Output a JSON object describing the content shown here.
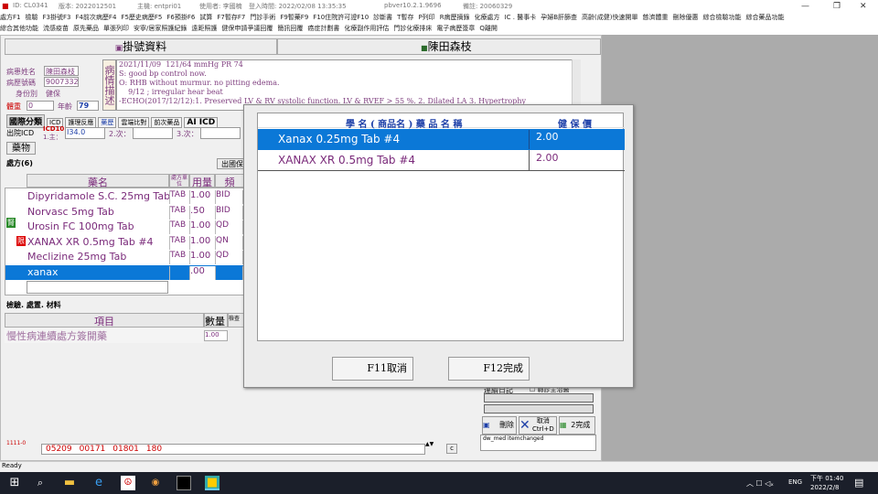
{
  "titlebar": {
    "id": "ID: CL0341",
    "host": "版本: 2022012501",
    "server": "主機: entpri01",
    "user": "使用者: 李國楠",
    "login": "登入時間: 2022/02/08 13:35:35",
    "version": "pbver10.2.1.9696",
    "note": "備註: 20060329"
  },
  "menu1": [
    "處方F1",
    "檢驗",
    "F3掛號F3",
    "F4前次病歷F4",
    "F5歷史病歷F5",
    "F6預掛F6",
    "試算",
    "F7暫存F7",
    "門診手術",
    "F9暫藥F9",
    "F10住院許可證F10",
    "診斷書",
    "T暫存",
    "P列印",
    "R病歷摘錄",
    "化療處方",
    "IC . 醫事卡",
    "孕婦B肝篩查",
    "高齡(成健)快速開單",
    "慈濟體重",
    "刪除優惠",
    "綜合檢驗功能",
    "綜合藥品功能"
  ],
  "menu2": [
    "綜合其他功能",
    "流感疫苗",
    "原先藥品",
    "單張列印",
    "安寧/居家照護紀錄",
    "遠距照護",
    "健保申請爭議回覆",
    "簡訊回覆",
    "癌症計劃書",
    "化療副作用評估",
    "門診化療排床",
    "電子病歷簽章",
    "Q離開"
  ],
  "app": {
    "left_header": "掛號資料",
    "right_header": "陳田森枝",
    "patient_name_label": "病患姓名",
    "patient_name": "陳田森枝",
    "chart_no_label": "病歷號碼",
    "chart_no": "9007332",
    "identity_label": "身份別",
    "identity": "健保",
    "weight_label": "體重",
    "weight": "0",
    "age_label": "年齡",
    "age": "79",
    "condition_box": "病情描述",
    "notes": [
      "2021/11/09  121/64 mmHg PR 74",
      "S: good bp control now.",
      "O: RHB without murmur. no pitting edema.",
      "    9/12 ; irregular hear beat",
      "-ECHO(2017/12/12):1. Preserved LV & RV systolic function. LV & RVEF > 55 %. 2. Dilated LA 3. Hypertrophy"
    ],
    "tabs": [
      "國際分類",
      "ICD",
      "護理反應",
      "藥歷",
      "雲端比對",
      "前次藥品",
      "AI ICD"
    ],
    "icd_label": "出院ICD",
    "icd_sub": "ICD10",
    "icd_main_label": "1.主：",
    "icd_main": "I34.0",
    "icd_2": "2.次：",
    "icd_3": "3.次：",
    "med_tab": "藥物",
    "rx_label": "處方(6)",
    "rx_btn": "出國保",
    "col_drug": "藥名",
    "col_form": "處方單位",
    "col_qty": "用量",
    "col_freq": "頻",
    "meds": [
      {
        "name": "Dipyridamole S.C. 25mg Tab",
        "form": "TAB",
        "qty": "1.00",
        "freq": "BID",
        "tag": ""
      },
      {
        "name": "Norvasc 5mg Tab",
        "form": "TAB",
        ".50": "",
        "qty": ".50",
        "freq": "BID",
        "tag": ""
      },
      {
        "name": "Urosin FC 100mg Tab",
        "form": "TAB",
        "qty": "1.00",
        "freq": "QD",
        "tag": "腎"
      },
      {
        "name": "XANAX XR 0.5mg Tab #4",
        "form": "TAB",
        "qty": "1.00",
        "freq": "QN",
        "tag": "限"
      },
      {
        "name": "Meclizine 25mg Tab",
        "form": "TAB",
        "qty": "1.00",
        "freq": "QD",
        "tag": ""
      },
      {
        "name": "xanax",
        "form": "",
        "qty": ".00",
        "freq": "",
        "tag": ""
      }
    ],
    "exam_label": "檢驗. 處置. 材料",
    "col_item": "項目",
    "col_count": "數量",
    "col_check": "檢查",
    "exam_item": "慢性病連續處方簽開藥",
    "exam_count": "1.00",
    "bottom_code": "1111-0",
    "bottom_values": [
      "05209",
      "00171",
      "01801",
      "180"
    ],
    "bottom_c": "c",
    "right_sect": "連續日記",
    "right_chk": "轉診主治醫",
    "btn_delete": "刪除",
    "btn_cancel": "取消 Ctrl+D",
    "btn_done": "2完成",
    "dw_text": "dw_med  itemchanged"
  },
  "modal": {
    "col_name": "學 名 ( 商品名 ) 藥 品 名 稱",
    "col_price": "健 保 價",
    "rows": [
      {
        "name": "Xanax 0.25mg Tab #4",
        "price": "2.00"
      },
      {
        "name": "XANAX XR 0.5mg Tab #4",
        "price": "2.00"
      }
    ],
    "btn_cancel": "F11取消",
    "btn_done": "F12完成"
  },
  "status": "Ready",
  "taskbar": {
    "ime": "ENG",
    "time": "下午 01:40",
    "date": "2022/2/8"
  },
  "colors": {
    "selected": "#0b78d7",
    "purple": "#7a2a7a",
    "modal_header": "#1d3fa8"
  }
}
